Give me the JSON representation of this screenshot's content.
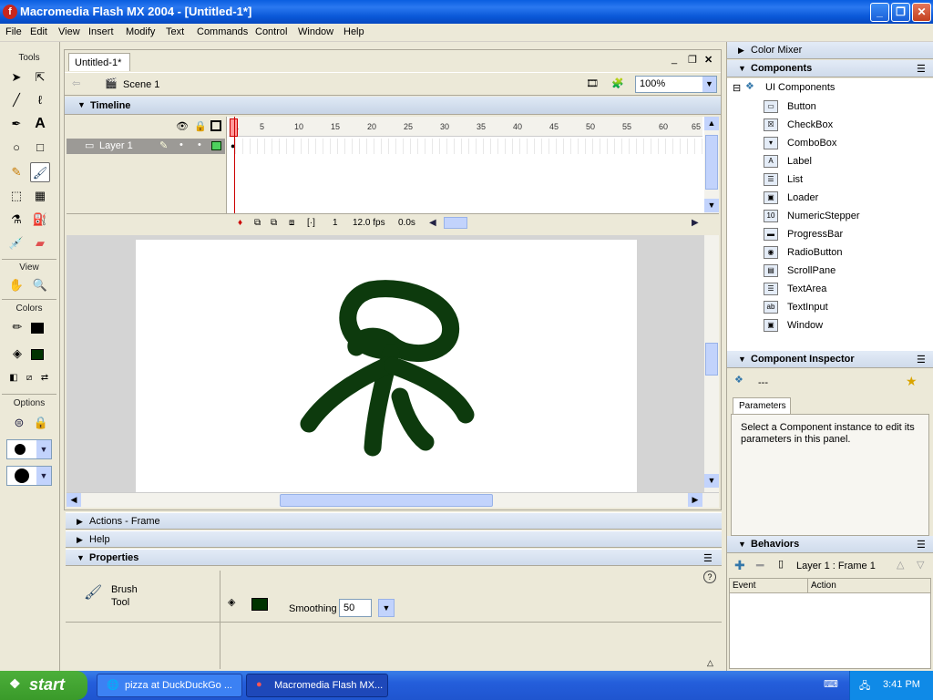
{
  "window": {
    "title": "Macromedia Flash MX 2004 - [Untitled-1*]",
    "app_icon_glyph": "f"
  },
  "menu": [
    "File",
    "Edit",
    "View",
    "Insert",
    "Modify",
    "Text",
    "Commands",
    "Control",
    "Window",
    "Help"
  ],
  "tools": {
    "header": "Tools",
    "view_header": "View",
    "colors_header": "Colors",
    "options_header": "Options",
    "stroke_color": "#000000",
    "fill_color": "#003300"
  },
  "document": {
    "tab": "Untitled-1*",
    "scene": "Scene 1",
    "zoom": "100%"
  },
  "timeline": {
    "title": "Timeline",
    "layer_name": "Layer 1",
    "frame_ticks": [
      "1",
      "5",
      "10",
      "15",
      "20",
      "25",
      "30",
      "35",
      "40",
      "45",
      "50",
      "55",
      "60",
      "65"
    ],
    "current_frame": "1",
    "fps": "12.0 fps",
    "elapsed": "0.0s"
  },
  "panels": {
    "actions": "Actions - Frame",
    "help": "Help",
    "properties": "Properties"
  },
  "properties": {
    "tool_name": "Brush",
    "tool_label": "Tool",
    "smoothing_label": "Smoothing",
    "smoothing_value": "50"
  },
  "right": {
    "color_mixer": "Color Mixer",
    "components": "Components",
    "ui_components": "UI Components",
    "items": [
      "Button",
      "CheckBox",
      "ComboBox",
      "Label",
      "List",
      "Loader",
      "NumericStepper",
      "ProgressBar",
      "RadioButton",
      "ScrollPane",
      "TextArea",
      "TextInput",
      "Window"
    ],
    "inspector": "Component Inspector",
    "inspector_value": "---",
    "parameters_tab": "Parameters",
    "inspector_msg": "Select a Component instance to edit its parameters in this panel.",
    "behaviors": "Behaviors",
    "behaviors_target": "Layer 1 : Frame 1",
    "col_event": "Event",
    "col_action": "Action"
  },
  "taskbar": {
    "start": "start",
    "tasks": [
      "pizza at DuckDuckGo ...",
      "Macromedia Flash MX..."
    ],
    "clock": "3:41 PM"
  },
  "drawing": {
    "stroke_color": "#0d3a0d"
  }
}
